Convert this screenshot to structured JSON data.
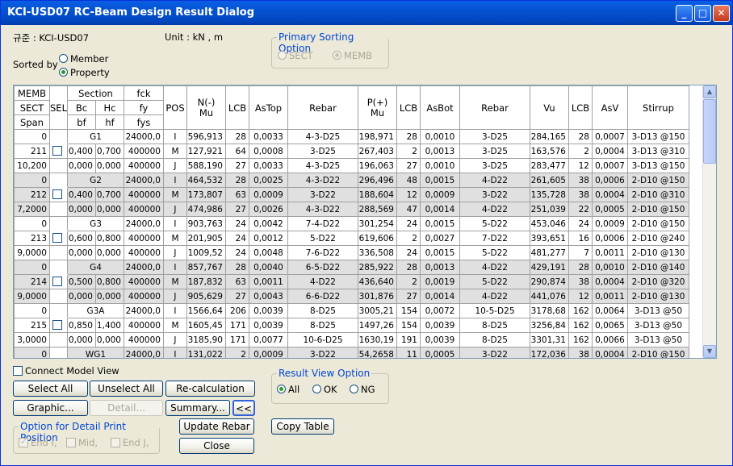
{
  "title": "KCI-USD07 RC-Beam Design Result Dialog",
  "window_buttons": {
    "minimize": "_",
    "maximize": "□",
    "close": "✕"
  },
  "code_label": "규준 : KCI-USD07",
  "unit_label": "Unit :  kN    ,    m",
  "sorted_by": "Sorted by",
  "sort_member": "Member",
  "sort_property": "Property",
  "primary_sort": {
    "caption": "Primary Sorting Option",
    "sect": "SECT",
    "memb": "MEMB"
  },
  "headers": {
    "memb": "MEMB",
    "sect": "SECT",
    "span": "Span",
    "sel": "SEL",
    "section": "Section",
    "bc": "Bc",
    "hc": "Hc",
    "bf": "bf",
    "hf": "hf",
    "fck": "fck",
    "fy": "fy",
    "fys": "fys",
    "pos": "POS",
    "nmu": "N(-)\nMu",
    "lcb": "LCB",
    "astop": "AsTop",
    "rebar": "Rebar",
    "pmu": "P(+)\nMu",
    "lcb2": "LCB",
    "asbot": "AsBot",
    "rebar2": "Rebar",
    "vu": "Vu",
    "lcb3": "LCB",
    "asv": "AsV",
    "stirrup": "Stirrup"
  },
  "rows": [
    [
      "0",
      "",
      "G1",
      "",
      "24000,0",
      "I",
      "596,913",
      "28",
      "0,0033",
      "4-3-D25",
      "198,971",
      "28",
      "0,0010",
      "3-D25",
      "284,165",
      "28",
      "0,0007",
      "3-D13 @150"
    ],
    [
      "211",
      "",
      "0,400",
      "0,700",
      "400000",
      "M",
      "127,921",
      "64",
      "0,0008",
      "3-D25",
      "267,403",
      "2",
      "0,0013",
      "3-D25",
      "163,576",
      "2",
      "0,0004",
      "3-D13 @310"
    ],
    [
      "10,200",
      "",
      "0,000",
      "0,000",
      "400000",
      "J",
      "588,190",
      "27",
      "0,0033",
      "4-3-D25",
      "196,063",
      "27",
      "0,0010",
      "3-D25",
      "283,477",
      "12",
      "0,0007",
      "3-D13 @150"
    ],
    [
      "0",
      "",
      "G2",
      "",
      "24000,0",
      "I",
      "464,532",
      "28",
      "0,0025",
      "4-3-D22",
      "296,496",
      "48",
      "0,0015",
      "4-D22",
      "261,605",
      "38",
      "0,0006",
      "2-D10 @150"
    ],
    [
      "212",
      "",
      "0,400",
      "0,700",
      "400000",
      "M",
      "173,807",
      "63",
      "0,0009",
      "3-D22",
      "188,604",
      "12",
      "0,0009",
      "3-D22",
      "135,728",
      "38",
      "0,0004",
      "2-D10 @310"
    ],
    [
      "7,2000",
      "",
      "0,000",
      "0,000",
      "400000",
      "J",
      "474,986",
      "27",
      "0,0026",
      "4-3-D22",
      "288,569",
      "47",
      "0,0014",
      "4-D22",
      "251,039",
      "22",
      "0,0005",
      "2-D10 @150"
    ],
    [
      "0",
      "",
      "G3",
      "",
      "24000,0",
      "I",
      "903,763",
      "24",
      "0,0042",
      "7-4-D22",
      "301,254",
      "24",
      "0,0015",
      "5-D22",
      "453,046",
      "24",
      "0,0009",
      "2-D10 @150"
    ],
    [
      "213",
      "",
      "0,600",
      "0,800",
      "400000",
      "M",
      "201,905",
      "24",
      "0,0012",
      "5-D22",
      "619,606",
      "2",
      "0,0027",
      "7-D22",
      "393,651",
      "16",
      "0,0006",
      "2-D10 @240"
    ],
    [
      "9,0000",
      "",
      "0,000",
      "0,000",
      "400000",
      "J",
      "1009,52",
      "24",
      "0,0048",
      "7-6-D22",
      "336,508",
      "24",
      "0,0015",
      "5-D22",
      "481,277",
      "7",
      "0,0011",
      "2-D10 @130"
    ],
    [
      "0",
      "",
      "G4",
      "",
      "24000,0",
      "I",
      "857,767",
      "28",
      "0,0040",
      "6-5-D22",
      "285,922",
      "28",
      "0,0013",
      "4-D22",
      "429,191",
      "28",
      "0,0010",
      "2-D10 @140"
    ],
    [
      "214",
      "",
      "0,500",
      "0,800",
      "400000",
      "M",
      "187,832",
      "63",
      "0,0011",
      "4-D22",
      "436,640",
      "2",
      "0,0019",
      "5-D22",
      "290,874",
      "38",
      "0,0004",
      "2-D10 @320"
    ],
    [
      "9,0000",
      "",
      "0,000",
      "0,000",
      "400000",
      "J",
      "905,629",
      "27",
      "0,0043",
      "6-6-D22",
      "301,876",
      "27",
      "0,0014",
      "4-D22",
      "441,076",
      "12",
      "0,0011",
      "2-D10 @130"
    ],
    [
      "0",
      "",
      "G3A",
      "",
      "24000,0",
      "I",
      "1566,64",
      "206",
      "0,0039",
      "8-D25",
      "3005,21",
      "154",
      "0,0072",
      "10-5-D25",
      "3178,68",
      "162",
      "0,0064",
      "3-D13 @50"
    ],
    [
      "215",
      "",
      "0,850",
      "1,400",
      "400000",
      "M",
      "1605,45",
      "171",
      "0,0039",
      "8-D25",
      "1497,26",
      "154",
      "0,0039",
      "8-D25",
      "3256,84",
      "162",
      "0,0065",
      "3-D13 @50"
    ],
    [
      "3,0000",
      "",
      "0,000",
      "0,000",
      "400000",
      "J",
      "3185,90",
      "171",
      "0,0077",
      "10-6-D25",
      "1630,19",
      "191",
      "0,0039",
      "8-D25",
      "3301,31",
      "162",
      "0,0066",
      "3-D13 @50"
    ],
    [
      "0",
      "",
      "WG1",
      "",
      "24000,0",
      "I",
      "131,022",
      "2",
      "0,0009",
      "3-D22",
      "54,2658",
      "11",
      "0,0005",
      "3-D22",
      "172,036",
      "38",
      "0,0004",
      "2-D10 @150"
    ]
  ],
  "connect_model_view": "Connect Model View",
  "buttons": {
    "select_all": "Select All",
    "unselect_all": "Unselect All",
    "recalc": "Re-calculation",
    "graphic": "Graphic...",
    "detail": "Detail...",
    "summary": "Summary...",
    "collapse": "<<",
    "update_rebar": "Update Rebar",
    "copy_table": "Copy Table",
    "close": "Close"
  },
  "result_view": {
    "caption": "Result View Option",
    "all": "All",
    "ok": "OK",
    "ng": "NG"
  },
  "detail_print": {
    "caption": "Option for Detail Print Position",
    "end_i": "End I,",
    "mid": "Mid,",
    "end_j": "End J,"
  }
}
